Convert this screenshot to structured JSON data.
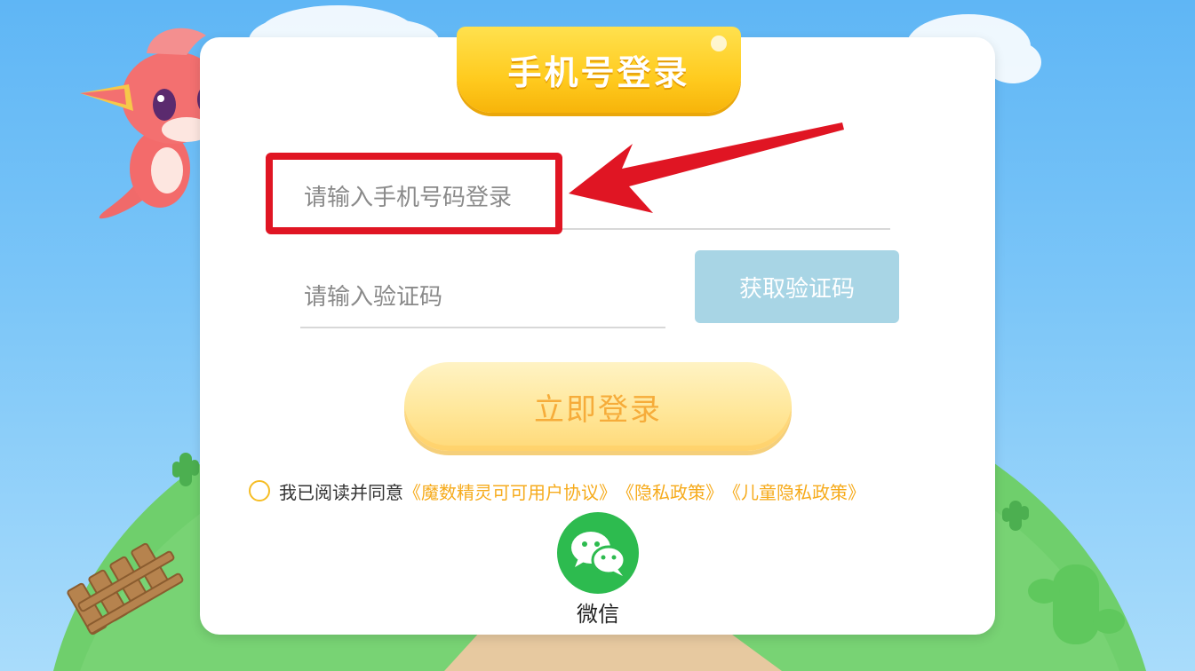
{
  "title": "手机号登录",
  "phone": {
    "placeholder": "请输入手机号码登录",
    "value": ""
  },
  "code": {
    "placeholder": "请输入验证码",
    "value": ""
  },
  "get_code_button": "获取验证码",
  "login_button": "立即登录",
  "agreement": {
    "checked": false,
    "prefix": "我已阅读并同意",
    "links": [
      "《魔数精灵可可用户协议》",
      "《隐私政策》",
      "《儿童隐私政策》"
    ]
  },
  "wechat": {
    "label": "微信",
    "icon": "wechat-icon"
  },
  "annotation": {
    "highlight_color": "#e01523",
    "arrow_color": "#e01523"
  },
  "colors": {
    "title_ribbon": "#ffcb1f",
    "login_button_text": "#f6ac3a",
    "link": "#f6ab1c",
    "get_code_button_bg": "#a8d5e5",
    "wechat_green": "#2dbb4f"
  }
}
